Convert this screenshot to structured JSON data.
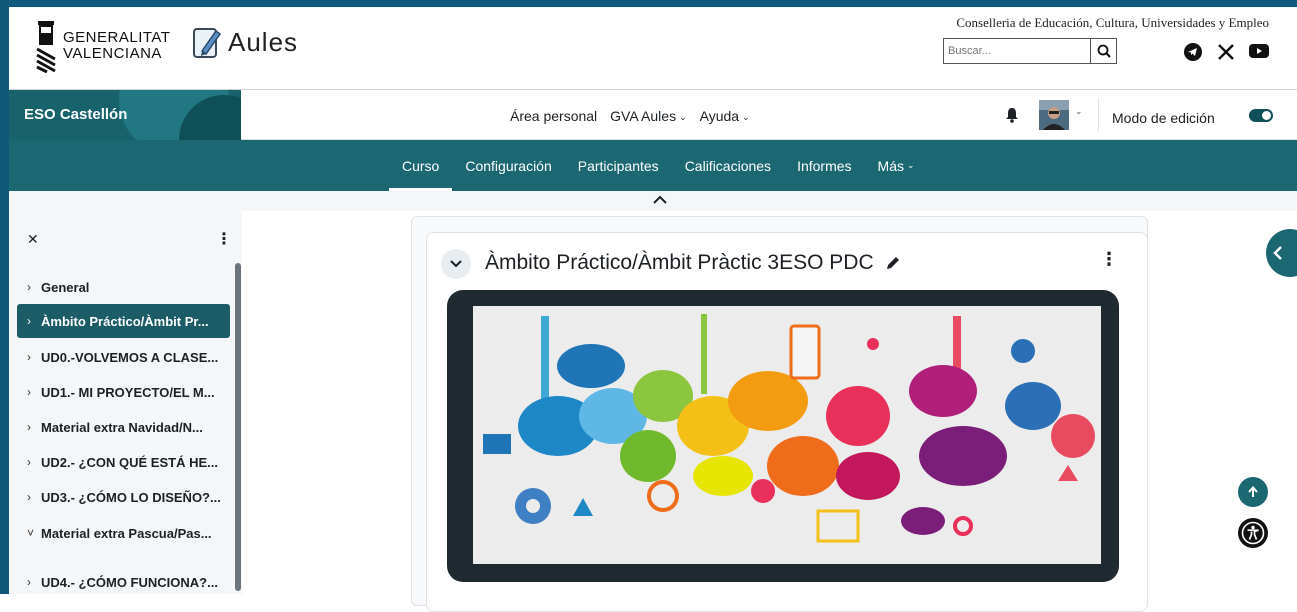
{
  "gva": {
    "logo_line1": "GENERALITAT",
    "logo_line2": "VALENCIANA",
    "app_name": "Aules",
    "conselleria": "Conselleria de Educación, Cultura, Universidades y Empleo",
    "search_placeholder": "Buscar...",
    "social_icons": [
      "telegram-icon",
      "x-icon",
      "youtube-icon"
    ]
  },
  "navbar": {
    "site_name": "ESO Castellón",
    "primary": [
      "Área personal",
      "GVA Aules",
      "Ayuda"
    ],
    "edit_mode_label": "Modo de edición",
    "edit_mode_on": true
  },
  "secondary_nav": {
    "items": [
      "Curso",
      "Configuración",
      "Participantes",
      "Calificaciones",
      "Informes",
      "Más"
    ],
    "active": "Curso"
  },
  "course_index": {
    "items": [
      {
        "label": "General",
        "expanded": false
      },
      {
        "label": "Àmbito Práctico/Àmbit Pr...",
        "expanded": false,
        "active": true
      },
      {
        "label": "UD0.-VOLVEMOS A CLASE...",
        "expanded": false
      },
      {
        "label": "UD1.- MI PROYECTO/EL M...",
        "expanded": false
      },
      {
        "label": "Material extra Navidad/N...",
        "expanded": false
      },
      {
        "label": "UD2.- ¿CON QUÉ ESTÁ HE...",
        "expanded": false
      },
      {
        "label": "UD3.- ¿CÓMO LO DISEÑO?...",
        "expanded": false
      },
      {
        "label": "Material extra Pascua/Pas...",
        "expanded": true
      },
      {
        "label": "UD4.- ¿CÓMO FUNCIONA?...",
        "expanded": false
      }
    ]
  },
  "section": {
    "title": "Àmbito Práctico/Àmbit Pràctic 3ESO PDC"
  },
  "colors": {
    "brand_teal": "#1b6772",
    "dark_teal": "#18626b",
    "active_item": "#1b5c66",
    "frame_blue": "#0f5a7a"
  }
}
